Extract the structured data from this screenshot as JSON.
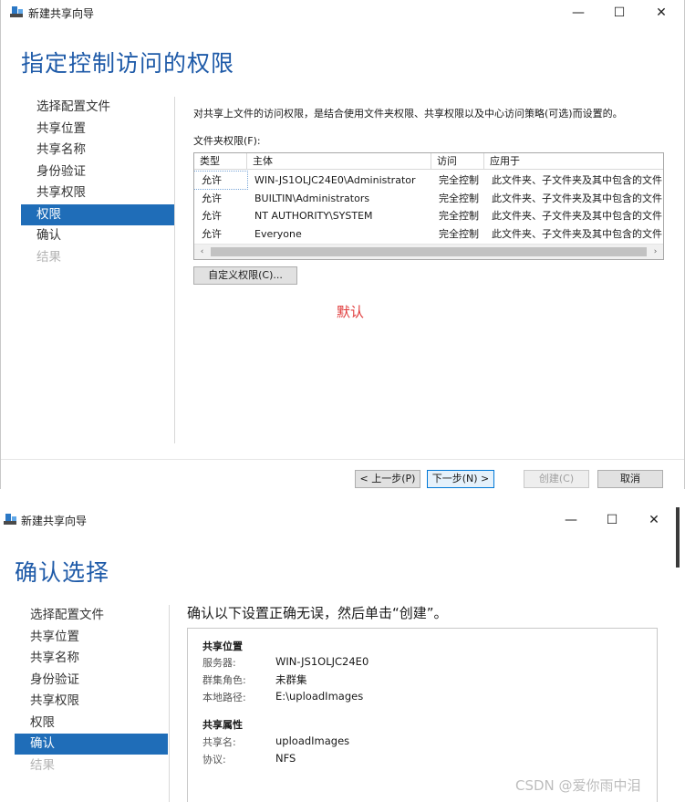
{
  "win1": {
    "title": "新建共享向导",
    "controls": {
      "minimize": "—",
      "maximize": "☐",
      "close": "✕"
    },
    "heading": "指定控制访问的权限",
    "nav": [
      {
        "label": "选择配置文件",
        "state": "normal"
      },
      {
        "label": "共享位置",
        "state": "normal"
      },
      {
        "label": "共享名称",
        "state": "normal"
      },
      {
        "label": "身份验证",
        "state": "normal"
      },
      {
        "label": "共享权限",
        "state": "normal"
      },
      {
        "label": "权限",
        "state": "active"
      },
      {
        "label": "确认",
        "state": "normal"
      },
      {
        "label": "结果",
        "state": "disabled"
      }
    ],
    "description": "对共享上文件的访问权限，是结合使用文件夹权限、共享权限以及中心访问策略(可选)而设置的。",
    "folder_perm_label": "文件夹权限(F):",
    "columns": [
      "类型",
      "主体",
      "访问",
      "应用于"
    ],
    "rows": [
      [
        "允许",
        "WIN-JS1OLJC24E0\\Administrator",
        "完全控制",
        "此文件夹、子文件夹及其中包含的文件"
      ],
      [
        "允许",
        "BUILTIN\\Administrators",
        "完全控制",
        "此文件夹、子文件夹及其中包含的文件"
      ],
      [
        "允许",
        "NT AUTHORITY\\SYSTEM",
        "完全控制",
        "此文件夹、子文件夹及其中包含的文件"
      ],
      [
        "允许",
        "Everyone",
        "完全控制",
        "此文件夹、子文件夹及其中包含的文件"
      ]
    ],
    "scroll_left": "‹",
    "scroll_right": "›",
    "customize_button": "自定义权限(C)...",
    "note": "默认",
    "buttons": {
      "prev": "< 上一步(P)",
      "next": "下一步(N) >",
      "create": "创建(C)",
      "cancel": "取消"
    }
  },
  "win2": {
    "title": "新建共享向导",
    "controls": {
      "minimize": "—",
      "maximize": "☐",
      "close": "✕"
    },
    "heading": "确认选择",
    "nav": [
      {
        "label": "选择配置文件",
        "state": "normal"
      },
      {
        "label": "共享位置",
        "state": "normal"
      },
      {
        "label": "共享名称",
        "state": "normal"
      },
      {
        "label": "身份验证",
        "state": "normal"
      },
      {
        "label": "共享权限",
        "state": "normal"
      },
      {
        "label": "权限",
        "state": "normal"
      },
      {
        "label": "确认",
        "state": "active"
      },
      {
        "label": "结果",
        "state": "disabled"
      }
    ],
    "confirm_title": "确认以下设置正确无误，然后单击“创建”。",
    "section1": {
      "header": "共享位置",
      "items": [
        {
          "key": "服务器:",
          "value": "WIN-JS1OLJC24E0"
        },
        {
          "key": "群集角色:",
          "value": "未群集"
        },
        {
          "key": "本地路径:",
          "value": "E:\\uploadImages"
        }
      ]
    },
    "section2": {
      "header": "共享属性",
      "items": [
        {
          "key": "共享名:",
          "value": "uploadImages"
        },
        {
          "key": "协议:",
          "value": "NFS"
        }
      ]
    }
  },
  "watermark": "CSDN @爱你雨中泪"
}
